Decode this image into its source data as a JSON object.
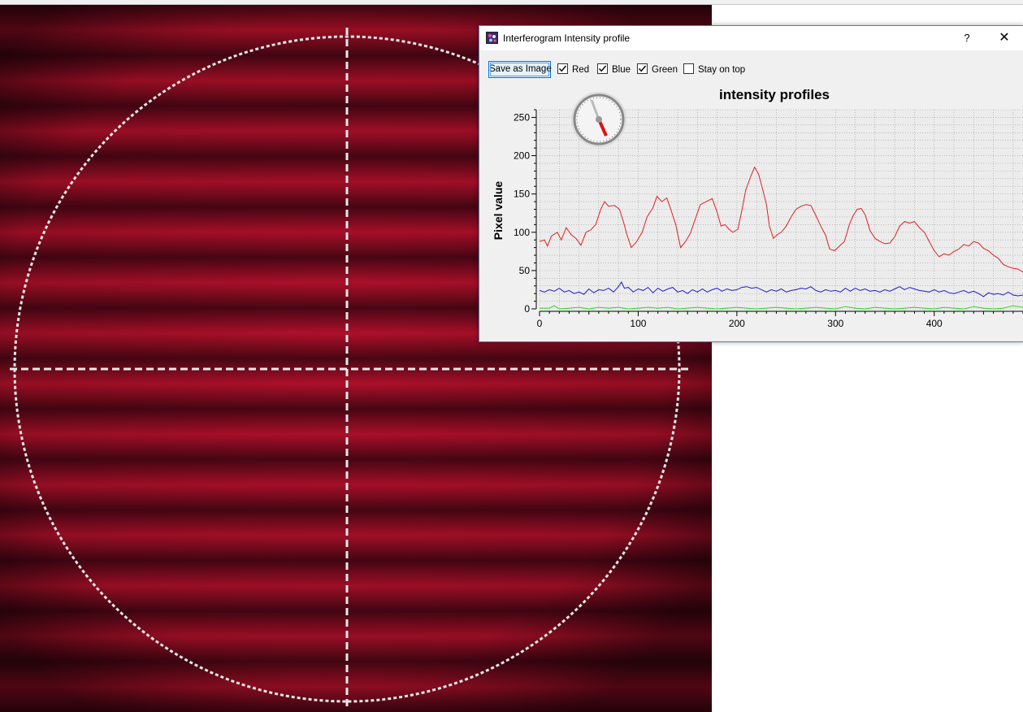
{
  "dialog": {
    "title": "Interferogram Intensity profile",
    "help_label": "?",
    "close_label": "✕",
    "save_label": "Save as Image",
    "checkboxes": [
      {
        "label": "Red",
        "checked": true
      },
      {
        "label": "Blue",
        "checked": true
      },
      {
        "label": "Green",
        "checked": true
      },
      {
        "label": "Stay on top",
        "checked": false
      }
    ]
  },
  "colors": {
    "red_series": "#e02020",
    "blue_series": "#1a1ad6",
    "green_series": "#22dd22",
    "fringe_bright": "#b0102a",
    "fringe_dark": "#4a0614",
    "overlay": "#e8e8e8"
  },
  "icons": [
    "app-icon",
    "gauge-icon",
    "close-icon"
  ],
  "chart_data": {
    "type": "line",
    "title": "intensity profiles",
    "xlabel": "",
    "ylabel": "Pixel value",
    "xlim": [
      0,
      490
    ],
    "ylim": [
      0,
      260
    ],
    "x_ticks": [
      0,
      100,
      200,
      300,
      400
    ],
    "y_ticks": [
      0,
      50,
      100,
      150,
      200,
      250
    ],
    "grid": true,
    "legend": "none",
    "series": [
      {
        "color": "red",
        "points": [
          [
            0,
            88
          ],
          [
            5,
            90
          ],
          [
            8,
            82
          ],
          [
            12,
            95
          ],
          [
            18,
            100
          ],
          [
            22,
            90
          ],
          [
            27,
            106
          ],
          [
            32,
            97
          ],
          [
            37,
            92
          ],
          [
            42,
            83
          ],
          [
            47,
            100
          ],
          [
            52,
            103
          ],
          [
            57,
            110
          ],
          [
            62,
            130
          ],
          [
            66,
            140
          ],
          [
            70,
            134
          ],
          [
            76,
            135
          ],
          [
            81,
            130
          ],
          [
            85,
            114
          ],
          [
            89,
            95
          ],
          [
            93,
            80
          ],
          [
            98,
            87
          ],
          [
            104,
            100
          ],
          [
            109,
            120
          ],
          [
            115,
            132
          ],
          [
            119,
            147
          ],
          [
            124,
            140
          ],
          [
            129,
            145
          ],
          [
            133,
            130
          ],
          [
            138,
            110
          ],
          [
            143,
            80
          ],
          [
            148,
            88
          ],
          [
            153,
            99
          ],
          [
            158,
            118
          ],
          [
            163,
            136
          ],
          [
            169,
            140
          ],
          [
            175,
            144
          ],
          [
            180,
            126
          ],
          [
            184,
            108
          ],
          [
            188,
            110
          ],
          [
            192,
            104
          ],
          [
            196,
            100
          ],
          [
            201,
            104
          ],
          [
            205,
            128
          ],
          [
            209,
            155
          ],
          [
            214,
            173
          ],
          [
            218,
            185
          ],
          [
            222,
            176
          ],
          [
            226,
            157
          ],
          [
            230,
            136
          ],
          [
            233,
            108
          ],
          [
            237,
            92
          ],
          [
            241,
            97
          ],
          [
            245,
            100
          ],
          [
            250,
            108
          ],
          [
            255,
            120
          ],
          [
            260,
            130
          ],
          [
            265,
            134
          ],
          [
            270,
            136
          ],
          [
            275,
            135
          ],
          [
            280,
            122
          ],
          [
            285,
            108
          ],
          [
            290,
            96
          ],
          [
            294,
            78
          ],
          [
            299,
            76
          ],
          [
            304,
            82
          ],
          [
            309,
            88
          ],
          [
            314,
            110
          ],
          [
            318,
            122
          ],
          [
            322,
            130
          ],
          [
            326,
            131
          ],
          [
            330,
            123
          ],
          [
            335,
            102
          ],
          [
            340,
            92
          ],
          [
            345,
            88
          ],
          [
            350,
            85
          ],
          [
            355,
            86
          ],
          [
            360,
            94
          ],
          [
            365,
            108
          ],
          [
            370,
            114
          ],
          [
            375,
            112
          ],
          [
            380,
            114
          ],
          [
            385,
            106
          ],
          [
            390,
            100
          ],
          [
            395,
            88
          ],
          [
            400,
            76
          ],
          [
            405,
            68
          ],
          [
            410,
            72
          ],
          [
            415,
            70
          ],
          [
            420,
            75
          ],
          [
            425,
            78
          ],
          [
            430,
            84
          ],
          [
            435,
            82
          ],
          [
            440,
            88
          ],
          [
            445,
            86
          ],
          [
            450,
            79
          ],
          [
            455,
            76
          ],
          [
            460,
            70
          ],
          [
            465,
            66
          ],
          [
            470,
            58
          ],
          [
            475,
            55
          ],
          [
            480,
            53
          ],
          [
            485,
            52
          ],
          [
            490,
            48
          ]
        ]
      },
      {
        "color": "blue",
        "points": [
          [
            0,
            24
          ],
          [
            5,
            22
          ],
          [
            10,
            25
          ],
          [
            15,
            23
          ],
          [
            20,
            27
          ],
          [
            25,
            22
          ],
          [
            30,
            24
          ],
          [
            35,
            20
          ],
          [
            40,
            22
          ],
          [
            45,
            19
          ],
          [
            50,
            26
          ],
          [
            55,
            21
          ],
          [
            60,
            25
          ],
          [
            65,
            24
          ],
          [
            70,
            27
          ],
          [
            75,
            22
          ],
          [
            80,
            29
          ],
          [
            83,
            35
          ],
          [
            86,
            27
          ],
          [
            90,
            28
          ],
          [
            95,
            22
          ],
          [
            100,
            26
          ],
          [
            105,
            24
          ],
          [
            110,
            28
          ],
          [
            115,
            21
          ],
          [
            120,
            27
          ],
          [
            125,
            23
          ],
          [
            130,
            26
          ],
          [
            135,
            28
          ],
          [
            140,
            22
          ],
          [
            145,
            24
          ],
          [
            150,
            20
          ],
          [
            155,
            25
          ],
          [
            160,
            22
          ],
          [
            165,
            26
          ],
          [
            170,
            22
          ],
          [
            175,
            25
          ],
          [
            180,
            27
          ],
          [
            185,
            23
          ],
          [
            190,
            26
          ],
          [
            195,
            24
          ],
          [
            200,
            25
          ],
          [
            205,
            28
          ],
          [
            210,
            29
          ],
          [
            215,
            27
          ],
          [
            220,
            28
          ],
          [
            225,
            25
          ],
          [
            230,
            22
          ],
          [
            235,
            25
          ],
          [
            240,
            23
          ],
          [
            245,
            26
          ],
          [
            250,
            22
          ],
          [
            255,
            24
          ],
          [
            260,
            25
          ],
          [
            265,
            27
          ],
          [
            270,
            26
          ],
          [
            275,
            29
          ],
          [
            280,
            24
          ],
          [
            285,
            22
          ],
          [
            290,
            25
          ],
          [
            295,
            23
          ],
          [
            300,
            24
          ],
          [
            305,
            22
          ],
          [
            310,
            27
          ],
          [
            315,
            23
          ],
          [
            320,
            27
          ],
          [
            325,
            24
          ],
          [
            330,
            26
          ],
          [
            335,
            23
          ],
          [
            340,
            24
          ],
          [
            345,
            22
          ],
          [
            350,
            25
          ],
          [
            355,
            23
          ],
          [
            360,
            26
          ],
          [
            365,
            29
          ],
          [
            370,
            25
          ],
          [
            375,
            28
          ],
          [
            380,
            26
          ],
          [
            385,
            24
          ],
          [
            390,
            23
          ],
          [
            395,
            22
          ],
          [
            400,
            25
          ],
          [
            405,
            22
          ],
          [
            410,
            24
          ],
          [
            415,
            21
          ],
          [
            420,
            20
          ],
          [
            425,
            22
          ],
          [
            430,
            24
          ],
          [
            435,
            21
          ],
          [
            440,
            23
          ],
          [
            445,
            20
          ],
          [
            450,
            16
          ],
          [
            455,
            21
          ],
          [
            460,
            19
          ],
          [
            465,
            20
          ],
          [
            470,
            18
          ],
          [
            475,
            22
          ],
          [
            480,
            18
          ],
          [
            485,
            17
          ],
          [
            490,
            18
          ]
        ]
      },
      {
        "color": "green",
        "points": [
          [
            0,
            1
          ],
          [
            10,
            1
          ],
          [
            15,
            4
          ],
          [
            20,
            0
          ],
          [
            30,
            1
          ],
          [
            40,
            2
          ],
          [
            50,
            0
          ],
          [
            60,
            2
          ],
          [
            70,
            1
          ],
          [
            80,
            2
          ],
          [
            90,
            0
          ],
          [
            100,
            1
          ],
          [
            110,
            2
          ],
          [
            120,
            1
          ],
          [
            130,
            2
          ],
          [
            140,
            0
          ],
          [
            150,
            1
          ],
          [
            160,
            2
          ],
          [
            170,
            1
          ],
          [
            180,
            0
          ],
          [
            190,
            1
          ],
          [
            200,
            2
          ],
          [
            210,
            1
          ],
          [
            220,
            0
          ],
          [
            230,
            1
          ],
          [
            240,
            2
          ],
          [
            250,
            1
          ],
          [
            260,
            0
          ],
          [
            270,
            1
          ],
          [
            280,
            2
          ],
          [
            290,
            1
          ],
          [
            300,
            0
          ],
          [
            310,
            3
          ],
          [
            320,
            1
          ],
          [
            330,
            0
          ],
          [
            340,
            2
          ],
          [
            350,
            1
          ],
          [
            360,
            0
          ],
          [
            370,
            1
          ],
          [
            380,
            2
          ],
          [
            390,
            1
          ],
          [
            400,
            0
          ],
          [
            410,
            2
          ],
          [
            420,
            1
          ],
          [
            430,
            0
          ],
          [
            440,
            3
          ],
          [
            450,
            1
          ],
          [
            460,
            0
          ],
          [
            470,
            1
          ],
          [
            480,
            4
          ],
          [
            490,
            2
          ]
        ]
      }
    ]
  }
}
